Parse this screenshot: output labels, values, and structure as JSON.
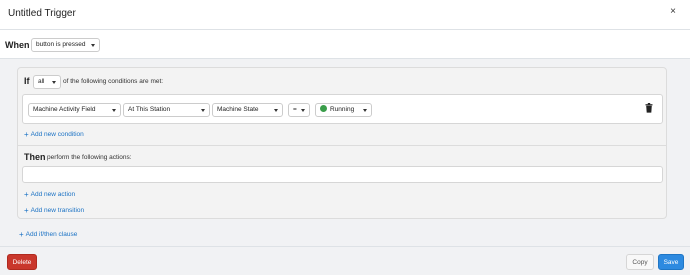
{
  "modal": {
    "title": "Untitled Trigger",
    "close_glyph": "×"
  },
  "when": {
    "label": "When",
    "trigger_value": "button is pressed"
  },
  "clause": {
    "if_label": "If",
    "match_value": "all",
    "match_suffix": "of the following conditions are met:",
    "condition": {
      "field": "Machine Activity Field",
      "scope": "At This Station",
      "property": "Machine State",
      "operator": "=",
      "value": "Running",
      "value_color": "#3a9d4a"
    },
    "add_condition": "Add new condition",
    "then_label": "Then",
    "then_suffix": "perform the following actions:",
    "add_action": "Add new action",
    "add_transition": "Add new transition"
  },
  "add_clause": "Add if/then clause",
  "footer": {
    "delete_label": "Delete",
    "copy_label": "Copy",
    "save_label": "Save"
  },
  "colors": {
    "accent": "#2d8ae0",
    "danger": "#c9372c",
    "link": "#1b72c4"
  }
}
